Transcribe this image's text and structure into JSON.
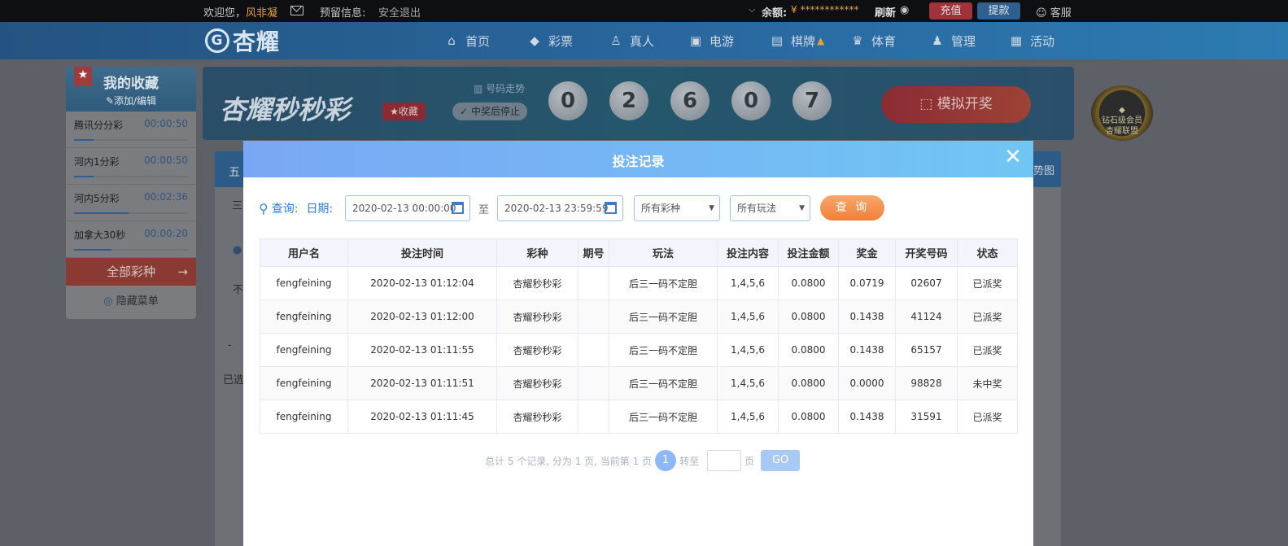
{
  "topbar": {
    "welcome": "欢迎您，",
    "username": "风非凝",
    "reserved_info": "预留信息:",
    "logout": "安全退出",
    "balance_label": "余额:",
    "balance_value": "¥ ************",
    "refresh": "刷新",
    "recharge": "充值",
    "withdraw": "提款",
    "service": "客服"
  },
  "nav": {
    "logo": "杏耀",
    "items": [
      "首页",
      "彩票",
      "真人",
      "电游",
      "棋牌",
      "体育",
      "管理",
      "活动"
    ]
  },
  "sidebar": {
    "title": "我的收藏",
    "subtitle": "添加/编辑",
    "items": [
      {
        "name": "腾讯分分彩",
        "time": "00:00:50"
      },
      {
        "name": "河内1分彩",
        "time": "00:00:50"
      },
      {
        "name": "河内5分彩",
        "time": "00:02:36"
      },
      {
        "name": "加拿大30秒",
        "time": "00:00:20"
      }
    ],
    "all_lottery": "全部彩种",
    "hide_menu": "隐藏菜单"
  },
  "game": {
    "title": "杏耀秒秒彩",
    "favorite": "收藏",
    "trend": "号码走势",
    "stop_on_win": "中奖后停止",
    "balls": [
      "0",
      "2",
      "6",
      "0",
      "7"
    ],
    "simulate": "模拟开奖",
    "vip_line1": "钻石级会员",
    "vip_line2": "杏耀联盟"
  },
  "background_text": {
    "tab_left": "五",
    "tab_right": "势图",
    "row1": "三",
    "row2": "不",
    "row3": "已选",
    "minus": "-"
  },
  "modal": {
    "title": "投注记录",
    "query_label": "查询:",
    "date_label": "日期:",
    "date_from": "2020-02-13 00:00:00",
    "to": "至",
    "date_to": "2020-02-13 23:59:59",
    "lottery_select": "所有彩种",
    "play_select": "所有玩法",
    "query_button": "查 询",
    "columns": [
      "用户名",
      "投注时间",
      "彩种",
      "期号",
      "玩法",
      "投注内容",
      "投注金额",
      "奖金",
      "开奖号码",
      "状态"
    ],
    "rows": [
      {
        "user": "fengfeining",
        "time": "2020-02-13 01:12:04",
        "lottery": "杏耀秒秒彩",
        "issue": "",
        "play": "后三一码不定胆",
        "content": "1,4,5,6",
        "amount": "0.0800",
        "prize": "0.0719",
        "number": "02607",
        "status": "已派奖"
      },
      {
        "user": "fengfeining",
        "time": "2020-02-13 01:12:00",
        "lottery": "杏耀秒秒彩",
        "issue": "",
        "play": "后三一码不定胆",
        "content": "1,4,5,6",
        "amount": "0.0800",
        "prize": "0.1438",
        "number": "41124",
        "status": "已派奖"
      },
      {
        "user": "fengfeining",
        "time": "2020-02-13 01:11:55",
        "lottery": "杏耀秒秒彩",
        "issue": "",
        "play": "后三一码不定胆",
        "content": "1,4,5,6",
        "amount": "0.0800",
        "prize": "0.1438",
        "number": "65157",
        "status": "已派奖"
      },
      {
        "user": "fengfeining",
        "time": "2020-02-13 01:11:51",
        "lottery": "杏耀秒秒彩",
        "issue": "",
        "play": "后三一码不定胆",
        "content": "1,4,5,6",
        "amount": "0.0800",
        "prize": "0.0000",
        "number": "98828",
        "status": "未中奖"
      },
      {
        "user": "fengfeining",
        "time": "2020-02-13 01:11:45",
        "lottery": "杏耀秒秒彩",
        "issue": "",
        "play": "后三一码不定胆",
        "content": "1,4,5,6",
        "amount": "0.0800",
        "prize": "0.1438",
        "number": "31591",
        "status": "已派奖"
      }
    ],
    "pager": {
      "summary": "总计 5 个记录, 分为 1 页, 当前第 1 页",
      "current": "1",
      "goto": "转至",
      "page": "页",
      "go": "GO"
    }
  },
  "colors": {
    "accent_orange": "#f0803a",
    "win_status": "#e46b2a",
    "lose_status": "#999999",
    "modal_header": "#7aa7f5"
  }
}
